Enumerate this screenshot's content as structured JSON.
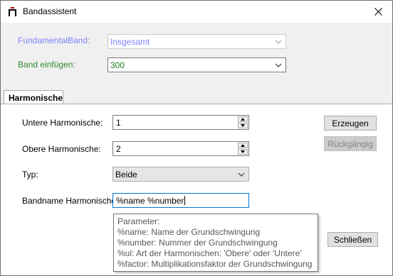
{
  "window": {
    "title": "Bandassistent",
    "icon": "band-assistant-icon",
    "close_icon": "close-icon"
  },
  "top": {
    "fundamental_label": "FundamentalBand:",
    "fundamental_value": "Insgesamt",
    "insert_label": "Band einfügen:",
    "insert_value": "300"
  },
  "tabs": [
    {
      "label": "Harmonische"
    }
  ],
  "harmonics": {
    "lower_label": "Untere Harmonische:",
    "lower_value": "1",
    "upper_label": "Obere Harmonische:",
    "upper_value": "2",
    "type_label": "Typ:",
    "type_value": "Beide",
    "bandname_label": "Bandname Harmonische:",
    "bandname_value": "%name %number"
  },
  "buttons": {
    "create": "Erzeugen",
    "undo": "Rückgängig",
    "close": "Schließen"
  },
  "tooltip": {
    "lines": [
      "Parameter:",
      "%name: Name der Grundschwingung",
      "%number: Nummer der Grundschwingung",
      "%ul: Art der Harmonischen: 'Obere' oder 'Untere'",
      "%factor: Multiplikationsfaktor der Grundschwingung"
    ]
  },
  "colors": {
    "disabled_label": "#8080ff",
    "enabled_label": "#2e8b2e",
    "focus_border": "#0078d7"
  }
}
